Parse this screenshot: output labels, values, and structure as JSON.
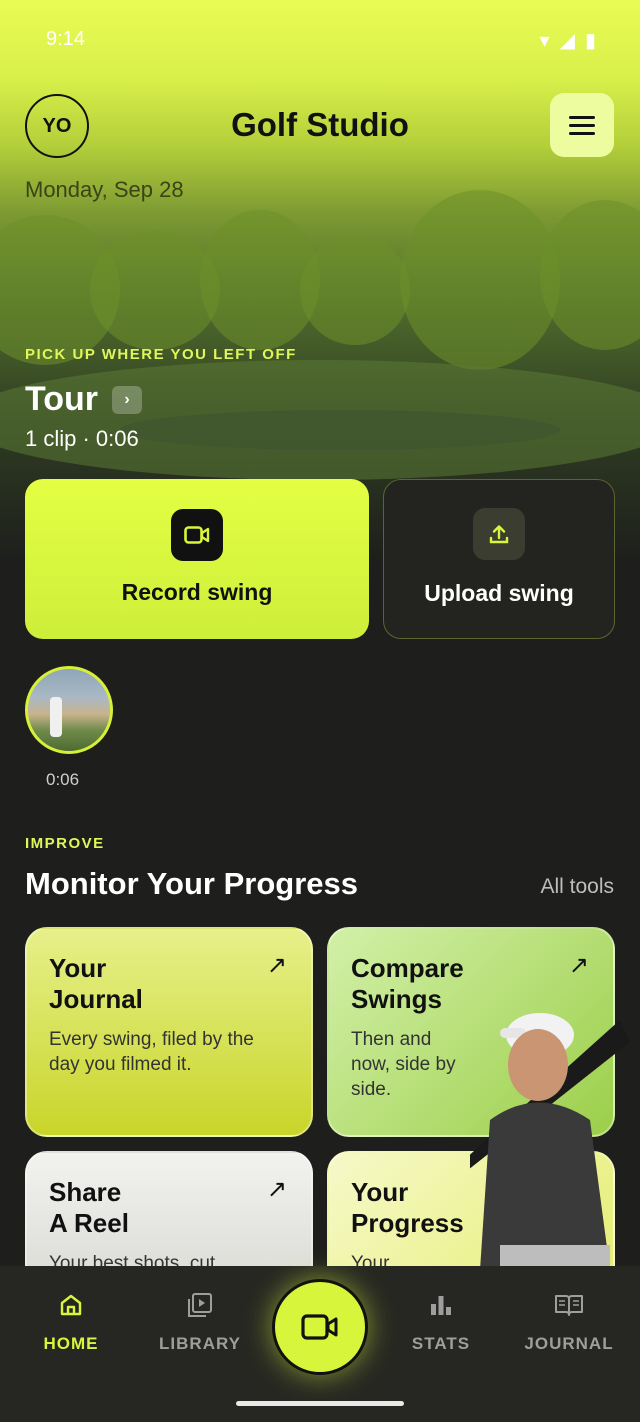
{
  "status_bar": {
    "time": "9:14"
  },
  "header": {
    "avatar_initials": "YO",
    "title": "Golf Studio",
    "date": "Monday, Sep 28"
  },
  "resume": {
    "kicker": "PICK UP WHERE YOU LEFT OFF",
    "title": "Tour",
    "info": "1 clip · 0:06"
  },
  "actions": {
    "record_label": "Record swing",
    "upload_label": "Upload swing"
  },
  "recent_clip": {
    "duration": "0:06"
  },
  "improve": {
    "kicker": "IMPROVE",
    "title": "Monitor Your Progress",
    "all_tools": "All tools",
    "cards": [
      {
        "title": "Your\nJournal",
        "desc": "Every swing, filed by the day you filmed it."
      },
      {
        "title": "Compare\nSwings",
        "desc": "Then and now, side by side."
      },
      {
        "title": "Share\nA Reel",
        "desc": "Your best shots, cut"
      },
      {
        "title": "Your\nProgress",
        "desc": "Your"
      }
    ]
  },
  "nav": {
    "home": "HOME",
    "library": "LIBRARY",
    "stats": "STATS",
    "journal": "JOURNAL"
  },
  "colors": {
    "accent": "#d9f53c",
    "background": "#1e1f1c"
  }
}
